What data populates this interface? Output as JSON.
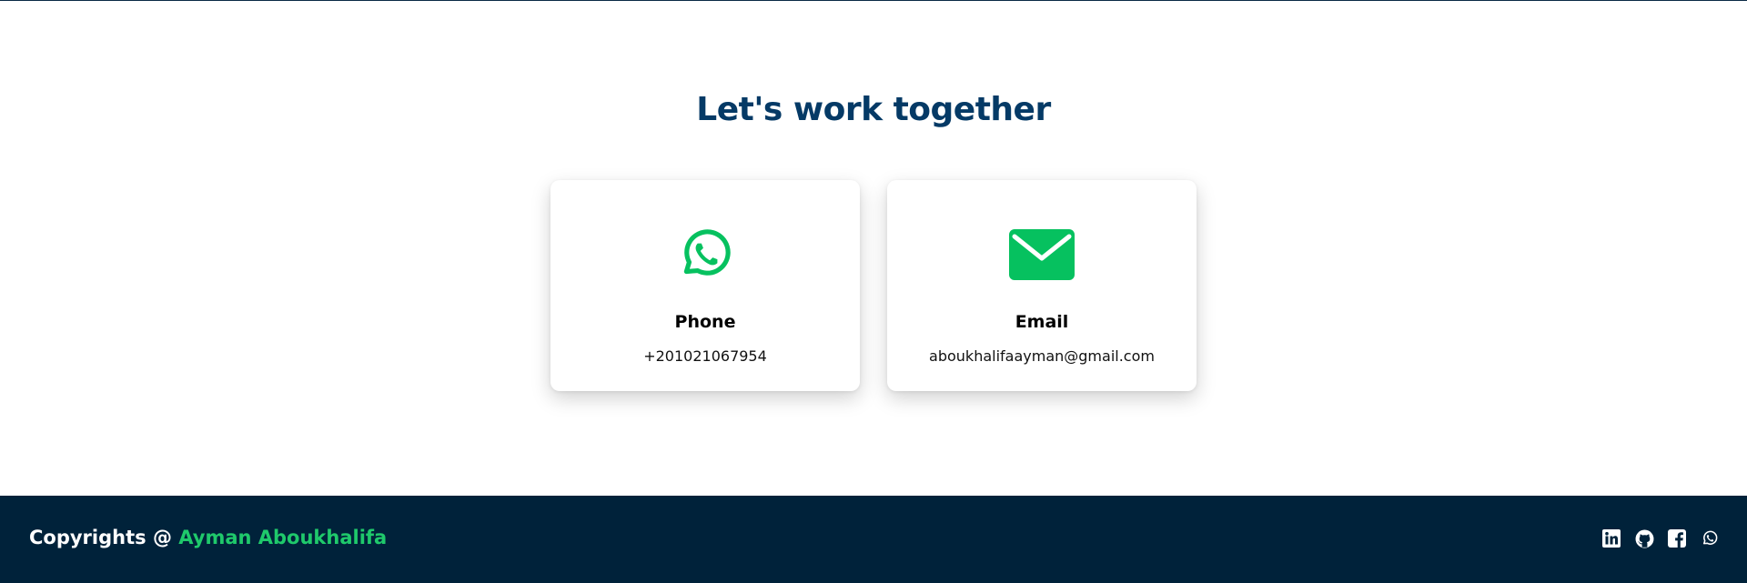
{
  "section": {
    "heading": "Let's work together"
  },
  "cards": [
    {
      "title": "Phone",
      "value": "+201021067954",
      "icon": "whatsapp-icon"
    },
    {
      "title": "Email",
      "value": "aboukhalifaayman@gmail.com",
      "icon": "envelope-icon"
    }
  ],
  "footer": {
    "prefix": "Copyrights @",
    "name": "Ayman Aboukhalifa",
    "socials": [
      "linkedin-icon",
      "github-icon",
      "facebook-icon",
      "whatsapp-icon"
    ]
  },
  "colors": {
    "heading": "#053a66",
    "accent": "#1fc96b",
    "footer_bg": "#00223a"
  }
}
